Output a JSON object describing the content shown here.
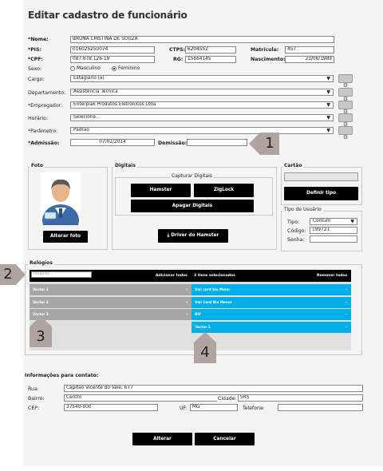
{
  "title": "Editar cadastro de funcionário",
  "labels": {
    "nome": "*Nome:",
    "pis": "*PIS:",
    "cpf": "*CPF:",
    "sexo": "Sexo:",
    "ctps": "CTPS:",
    "rg": "RG:",
    "matricula": "Matrícula:",
    "nascimento": "Nascimento:",
    "cargo": "Cargo:",
    "departamento": "Departamento:",
    "empregador": "*Empregador:",
    "horario": "Horário:",
    "parametro": "*Parâmetro:",
    "admissao": "*Admissão:",
    "demissao": "Demissão:"
  },
  "values": {
    "nome": "BRUNA CRISTINA DE SOUZA",
    "pis": "016025250074",
    "cpf": "087.678.126-19",
    "ctps": "6204552",
    "rg": "15664145",
    "matricula": "457",
    "nascimento": "23/06/1989",
    "admissao": "07/01/2014",
    "demissao": ""
  },
  "sexo": {
    "masculino": "Masculino",
    "feminino": "Feminino",
    "selected": "Feminino"
  },
  "selects": {
    "cargo": "Estagiário (a)",
    "departamento": "Assistência Técnica",
    "empregador": "Enterplak Produtos Eletronicos Ltda",
    "horario": "Selecione...",
    "parametro": "Padrao"
  },
  "foto": {
    "title": "Foto",
    "button": "Alterar foto"
  },
  "digitais": {
    "title": "Digitais",
    "capture_title": "Capturar Digitais",
    "hamster": "Hamster",
    "ziglock": "ZigLock",
    "apagar": "Apagar Digitais",
    "driver": "Driver do Hamster"
  },
  "cartao": {
    "title": "Cartão",
    "button": "Definir tipo"
  },
  "tipo_usuario": {
    "title": "Tipo de Usuário",
    "tipo_label": "Tipo:",
    "tipo_value": "Comum",
    "codigo_label": "Código:",
    "codigo_value": "199721",
    "senha_label": "Senha:",
    "senha_value": ""
  },
  "relogios": {
    "title": "Relógios",
    "search_placeholder": "Pesquisa...",
    "add_all": "Adicionar todos",
    "selected_count": "3 itens selecionados",
    "remove_all": "Remover todos",
    "available": [
      "Vector 2",
      "Vector 3",
      "Vector 3"
    ],
    "selected": [
      "Owi card bio Maior",
      "Owi Card Bio Menor",
      "RW",
      "Vector 1"
    ]
  },
  "contato": {
    "title": "Informações para contato:",
    "rua_label": "Rua:",
    "rua": "Capitão Vicente do Vale, 677",
    "bairro_label": "Bairro:",
    "bairro": "Centro",
    "cidade_label": "Cidade:",
    "cidade": "SRS",
    "cep_label": "CEP:",
    "cep": "37540-000",
    "uf_label": "UF:",
    "uf": "MG",
    "telefone_label": "Telefone:",
    "telefone": ""
  },
  "actions": {
    "alterar": "Alterar",
    "cancelar": "Cancelar"
  },
  "annotations": [
    "1",
    "2",
    "3",
    "4"
  ],
  "colors": {
    "accent": "#00aee8",
    "gray_item": "#a6a6a6",
    "annotation": "#b0a3a0"
  }
}
